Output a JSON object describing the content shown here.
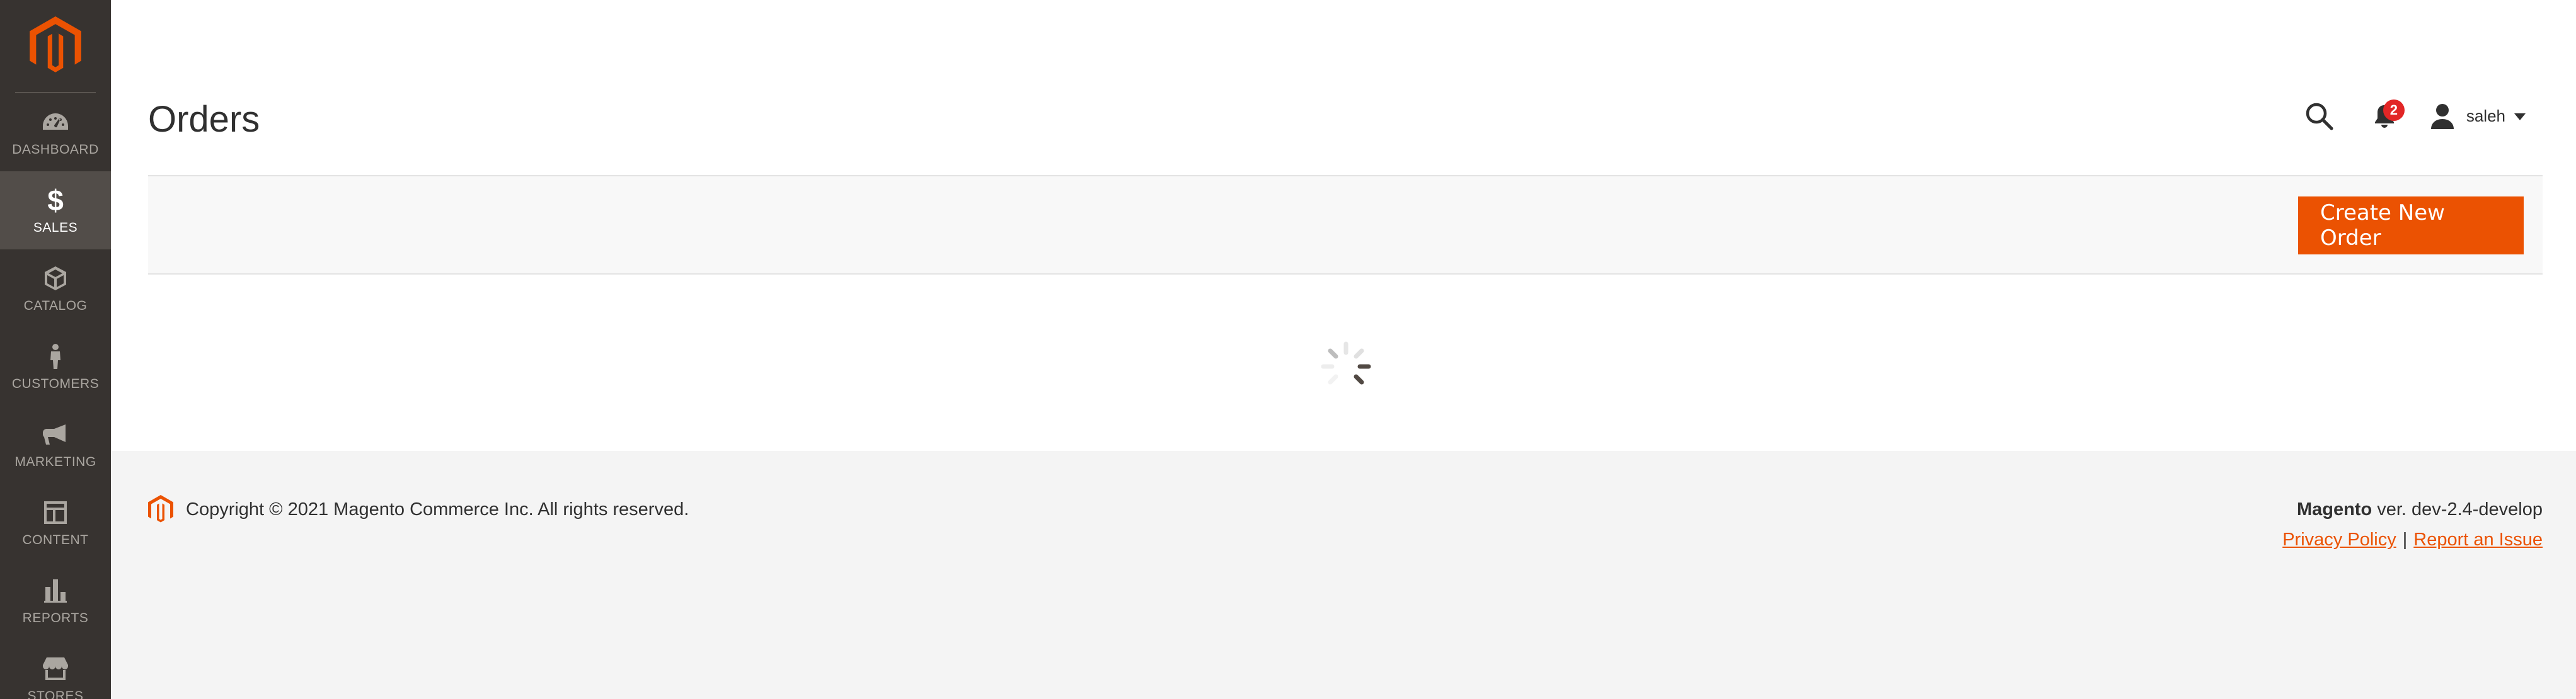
{
  "sidebar": {
    "logo": "magento-logo",
    "items": [
      {
        "label": "DASHBOARD",
        "icon": "dashboard-icon",
        "active": false
      },
      {
        "label": "SALES",
        "icon": "dollar-icon",
        "active": true
      },
      {
        "label": "CATALOG",
        "icon": "cube-icon",
        "active": false
      },
      {
        "label": "CUSTOMERS",
        "icon": "person-icon",
        "active": false
      },
      {
        "label": "MARKETING",
        "icon": "megaphone-icon",
        "active": false
      },
      {
        "label": "CONTENT",
        "icon": "layout-icon",
        "active": false
      },
      {
        "label": "REPORTS",
        "icon": "bar-chart-icon",
        "active": false
      },
      {
        "label": "STORES",
        "icon": "store-icon",
        "active": false
      }
    ]
  },
  "header": {
    "title": "Orders",
    "notifications_count": "2",
    "user_name": "saleh"
  },
  "actions": {
    "create_order_label": "Create New Order"
  },
  "footer": {
    "copyright": "Copyright © 2021 Magento Commerce Inc. All rights reserved.",
    "brand": "Magento",
    "version": " ver. dev-2.4-develop",
    "privacy_label": "Privacy Policy",
    "separator": "|",
    "report_label": "Report an Issue"
  },
  "colors": {
    "sidebar_bg": "#373330",
    "sidebar_active_bg": "#524d49",
    "accent": "#eb5202",
    "badge": "#e22626"
  }
}
